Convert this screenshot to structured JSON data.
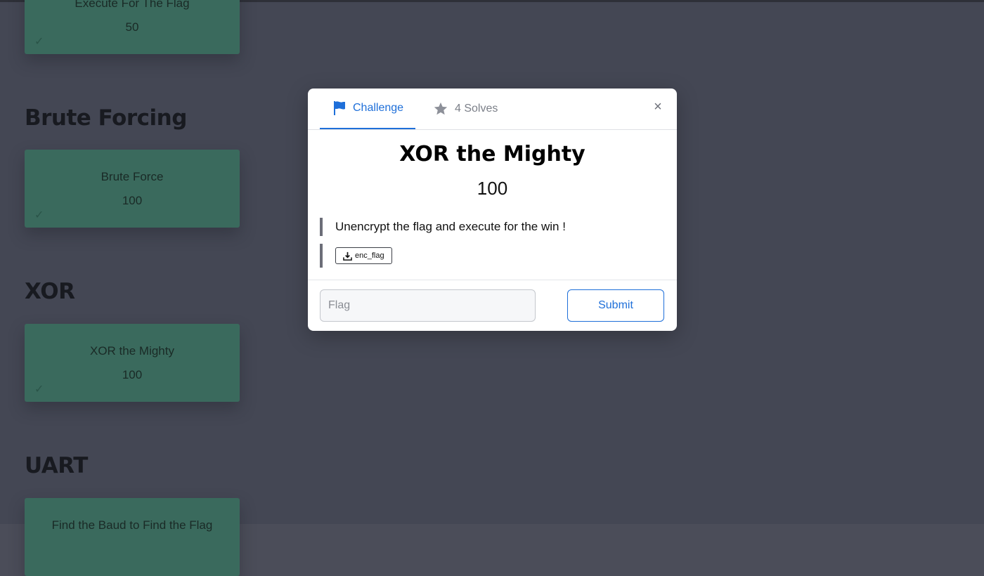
{
  "background": {
    "categories": [
      {
        "title": "",
        "challenges": [
          {
            "name": "Execute For The Flag",
            "points": "50",
            "solved_icon": "check-icon"
          }
        ]
      },
      {
        "title": "Brute Forcing",
        "challenges": [
          {
            "name": "Brute Force",
            "points": "100",
            "solved_icon": "check-icon"
          }
        ]
      },
      {
        "title": "XOR",
        "challenges": [
          {
            "name": "XOR the Mighty",
            "points": "100",
            "solved_icon": "check-icon"
          }
        ]
      },
      {
        "title": "UART",
        "challenges": [
          {
            "name": "Find the Baud to Find the Flag",
            "points": "",
            "solved_icon": ""
          }
        ]
      }
    ]
  },
  "modal": {
    "tabs": [
      {
        "label": "Challenge",
        "icon": "flag-icon",
        "active": true
      },
      {
        "label": "4 Solves",
        "icon": "star-icon",
        "active": false
      }
    ],
    "close_label": "×",
    "challenge": {
      "title": "XOR the Mighty",
      "points": "100",
      "description": "Unencrypt the flag and execute for the win !",
      "files": [
        {
          "name": "enc_flag",
          "icon": "download-icon"
        }
      ]
    },
    "flag_input": {
      "placeholder": "Flag",
      "value": ""
    },
    "submit_label": "Submit"
  },
  "colors": {
    "accent": "#1e6fd9",
    "card_solved": "#3a6a5d",
    "overlay": "#444754"
  }
}
